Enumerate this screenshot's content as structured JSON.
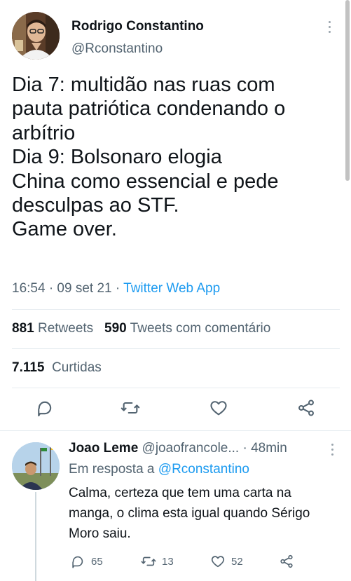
{
  "tweet": {
    "author_name": "Rodrigo Constantino",
    "author_handle": "@Rconstantino",
    "text": "Dia 7: multidão nas ruas com\npauta patriótica condenando o\narbítrio\nDia 9: Bolsonaro elogia\nChina como essencial e pede\ndesculpas ao STF.\nGame over.",
    "time": "16:54 · 09 set 21",
    "separator": " · ",
    "source": "Twitter Web App",
    "retweets_count": "881",
    "retweets_label": "Retweets",
    "quotes_count": "590",
    "quotes_label": "Tweets com comentário",
    "likes_count": "7.115",
    "likes_label": "Curtidas"
  },
  "reply": {
    "author_name": "Joao Leme",
    "author_handle": "@joaofrancole...",
    "time": "· 48min",
    "reply_prefix": "Em resposta a",
    "reply_to": "@Rconstantino",
    "text": "Calma, certeza que tem uma carta na manga, o clima esta igual quando Sérigo Moro saiu.",
    "replies": "65",
    "retweets": "13",
    "likes": "52"
  },
  "colors": {
    "link_blue": "#1d9bf0",
    "muted_gray": "#536471",
    "text_dark": "#0f1419",
    "icon_gray": "#536471"
  }
}
